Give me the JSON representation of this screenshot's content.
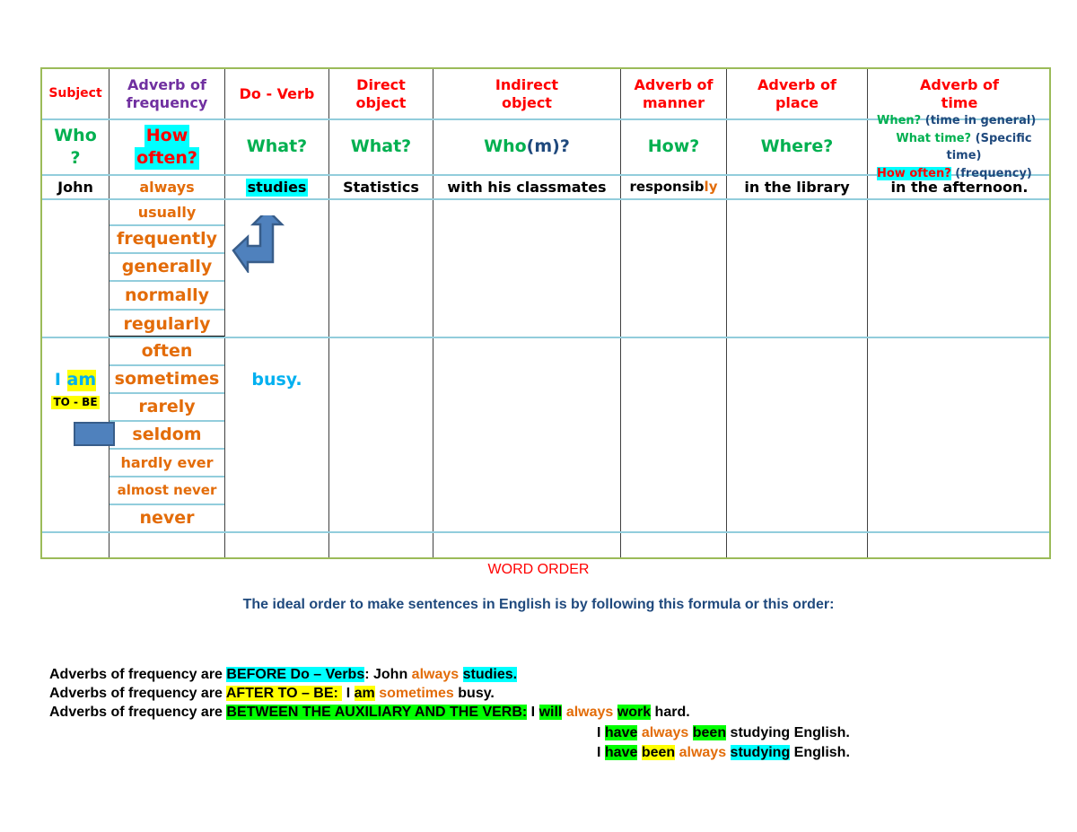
{
  "table": {
    "headers": [
      {
        "text": "Subject",
        "color": "#ff0000"
      },
      {
        "line1": "Adverb of",
        "line2": "frequency",
        "color": "#7030a0"
      },
      {
        "text": "Do - Verb",
        "color": "#ff0000"
      },
      {
        "line1": "Direct",
        "line2": "object",
        "color": "#ff0000"
      },
      {
        "line1": "Indirect",
        "line2": "object",
        "color": "#ff0000"
      },
      {
        "line1": "Adverb of",
        "line2": "manner",
        "color": "#ff0000"
      },
      {
        "line1": "Adverb of",
        "line2": "place",
        "color": "#ff0000"
      },
      {
        "line1": "Adverb of",
        "line2": "time",
        "color": "#ff0000"
      }
    ],
    "questions": {
      "subject": {
        "line1": "Who",
        "line2": "?"
      },
      "frequency": {
        "line1": "How",
        "line2": "often?"
      },
      "do_verb": "What?",
      "direct_object": "What?",
      "indirect_object": {
        "part1": "Who",
        "part2": "(m)",
        "part3": "?"
      },
      "manner": "How?",
      "place": "Where?",
      "time": [
        {
          "q": "When?",
          "note": "(time in general)"
        },
        {
          "q": "What time?",
          "note": "(Specific time)"
        },
        {
          "q": "How often?",
          "note": "(frequency)"
        }
      ]
    },
    "example_row": {
      "subject": "John",
      "frequency": "always",
      "do_verb": "studies",
      "direct_object": "Statistics",
      "indirect_object": "with his classmates",
      "manner_stem": "responsib",
      "manner_suffix": "ly",
      "place": "in the library",
      "time": "in the afternoon."
    },
    "adverbs_group1": [
      "usually",
      "frequently",
      "generally",
      "normally",
      "regularly"
    ],
    "adverbs_group2": [
      "often",
      "sometimes",
      "rarely",
      "seldom",
      "hardly ever",
      "almost never",
      "never"
    ],
    "to_be_row": {
      "subject_i": "I",
      "subject_am": "am",
      "to_be_label": "TO - BE",
      "complement": "busy."
    }
  },
  "document": {
    "title": "WORD ORDER",
    "intro": "The ideal order to make sentences in English is by following this formula or this order:",
    "rules": [
      {
        "prefix": "Adverbs of frequency are ",
        "rule": "BEFORE Do – Verbs",
        "sep": ": John ",
        "adverb": "always",
        "space": " ",
        "verb": "studies."
      },
      {
        "prefix": "Adverbs of frequency are ",
        "rule": "AFTER TO – BE: ",
        "sep": " I ",
        "aux": "am",
        "space": " ",
        "adverb": "sometimes",
        "rest": " busy."
      },
      {
        "prefix": "Adverbs of frequency are ",
        "rule": "BETWEEN THE AUXILIARY AND THE VERB:",
        "sep": " I "
      }
    ],
    "examples": [
      {
        "subj": "I ",
        "aux1": "will",
        "adv": "always",
        "verb": "work",
        "rest": " hard."
      },
      {
        "subj": "I ",
        "aux1": "have",
        "adv": "always",
        "aux2": "been",
        "rest": " studying English."
      },
      {
        "subj": "I ",
        "aux1": "have",
        "aux2": "been",
        "adv": "always",
        "verb": "studying",
        "rest": " English."
      }
    ]
  },
  "colors": {
    "header_red": "#ff0000",
    "frequency_purple": "#7030a0",
    "question_green": "#00b050",
    "adverb_orange": "#e36c09",
    "note_blue": "#1f497d",
    "cyan_highlight": "#00ffff",
    "yellow_highlight": "#ffff00",
    "green_highlight": "#00ff00",
    "table_border": "#9bbb59",
    "row_line": "#92cddc",
    "shape_blue": "#4f81bd"
  }
}
